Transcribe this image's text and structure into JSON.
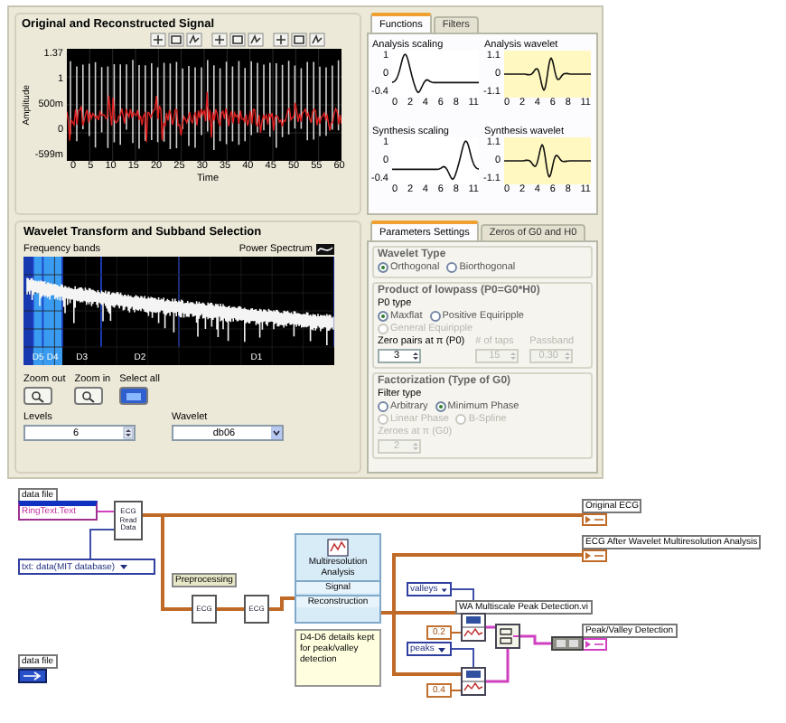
{
  "signal_panel": {
    "title": "Original and Reconstructed Signal",
    "y_label": "Amplitude",
    "x_label": "Time",
    "y_ticks": [
      "1.37",
      "1",
      "500m",
      "0",
      "-599m"
    ],
    "x_ticks": [
      "0",
      "5",
      "10",
      "15",
      "20",
      "25",
      "30",
      "35",
      "40",
      "45",
      "50",
      "55",
      "60"
    ]
  },
  "function_tabs": {
    "tabs": [
      {
        "label": "Functions",
        "selected": true
      },
      {
        "label": "Filters",
        "selected": false
      }
    ],
    "plots": [
      {
        "title": "Analysis scaling",
        "kind": "analysis-scaling",
        "y_ticks": [
          "1",
          "0",
          "-0.4"
        ],
        "x_ticks": [
          "0",
          "2",
          "4",
          "6",
          "8",
          "11"
        ]
      },
      {
        "title": "Analysis wavelet",
        "kind": "analysis-wavelet",
        "y_ticks": [
          "1.1",
          "0",
          "-1.1"
        ],
        "x_ticks": [
          "0",
          "2",
          "4",
          "6",
          "8",
          "11"
        ]
      },
      {
        "title": "Synthesis scaling",
        "kind": "synthesis-scaling",
        "y_ticks": [
          "1",
          "0",
          "-0.4"
        ],
        "x_ticks": [
          "0",
          "2",
          "4",
          "6",
          "8",
          "11"
        ]
      },
      {
        "title": "Synthesis wavelet",
        "kind": "synthesis-wavelet",
        "y_ticks": [
          "1.1",
          "0",
          "-1.1"
        ],
        "x_ticks": [
          "0",
          "2",
          "4",
          "6",
          "8",
          "11"
        ]
      }
    ]
  },
  "wavelet_panel": {
    "title": "Wavelet Transform and Subband Selection",
    "bands_label": "Frequency bands",
    "spectrum_label": "Power Spectrum",
    "bands": [
      {
        "label": "D5",
        "selected": true
      },
      {
        "label": "D4",
        "selected": true
      },
      {
        "label": "D3",
        "selected": false
      },
      {
        "label": "D2",
        "selected": false
      },
      {
        "label": "D1",
        "selected": false
      }
    ],
    "buttons": [
      {
        "label": "Zoom out",
        "kind": "zoom-out"
      },
      {
        "label": "Zoom in",
        "kind": "zoom-in"
      },
      {
        "label": "Select all",
        "kind": "select-all"
      }
    ],
    "levels": {
      "label": "Levels",
      "value": "6"
    },
    "wavelet": {
      "label": "Wavelet",
      "value": "db06"
    }
  },
  "parameters_tabs": {
    "tabs": [
      {
        "label": "Parameters Settings",
        "selected": true
      },
      {
        "label": "Zeros of G0 and H0",
        "selected": false
      }
    ],
    "wavelet_type": {
      "title": "Wavelet Type",
      "options": [
        {
          "label": "Orthogonal",
          "selected": true,
          "disabled": false
        },
        {
          "label": "Biorthogonal",
          "selected": false,
          "disabled": false
        }
      ]
    },
    "product": {
      "title": "Product of lowpass (P0=G0*H0)",
      "subtitle": "P0 type",
      "options": [
        {
          "label": "Maxflat",
          "selected": true,
          "disabled": false
        },
        {
          "label": "Positive Equiripple",
          "selected": false,
          "disabled": false
        },
        {
          "label": "General Equiripple",
          "selected": false,
          "disabled": true
        }
      ],
      "fields": [
        {
          "label": "Zero pairs at π (P0)",
          "value": "3",
          "disabled": false
        },
        {
          "label": "# of taps",
          "value": "15",
          "disabled": true
        },
        {
          "label": "Passband",
          "value": "0.30",
          "disabled": true
        }
      ]
    },
    "factorization": {
      "title": "Factorization (Type of G0)",
      "subtitle": "Filter type",
      "options": [
        {
          "label": "Arbitrary",
          "selected": false,
          "disabled": false
        },
        {
          "label": "Minimum Phase",
          "selected": true,
          "disabled": false
        },
        {
          "label": "Linear Phase",
          "selected": false,
          "disabled": true
        },
        {
          "label": "B-Spline",
          "selected": false,
          "disabled": true
        }
      ],
      "fields": [
        {
          "label": "Zeroes at π (G0)",
          "value": "2",
          "disabled": true
        }
      ]
    }
  },
  "block_diagram": {
    "file_label": "data file",
    "path_ring": "RingText.Text",
    "read_vi": [
      "ECG",
      "Read",
      "Data"
    ],
    "database_ring": "txt: data(MIT database)",
    "preprocessing_label": "Preprocessing",
    "preprocessing_vis": [
      [
        "ECG"
      ],
      [
        "ECG"
      ]
    ],
    "mra": {
      "title": "Multiresolution Analysis",
      "terminals": [
        "Signal",
        "Reconstruction"
      ]
    },
    "comment": "D4-D6 details kept for peak/valley detection",
    "indicators": [
      "Original ECG",
      "ECG After Wavelet Multiresolution Analysis",
      "Peak/Valley Detection"
    ],
    "peak_vi_label": "WA Multiscale Peak Detection.vi",
    "peak_rows": [
      {
        "ring": "valleys",
        "constant": "0.2"
      },
      {
        "ring": "peaks",
        "constant": "0.4"
      }
    ],
    "file_terminal_label": "data file"
  }
}
